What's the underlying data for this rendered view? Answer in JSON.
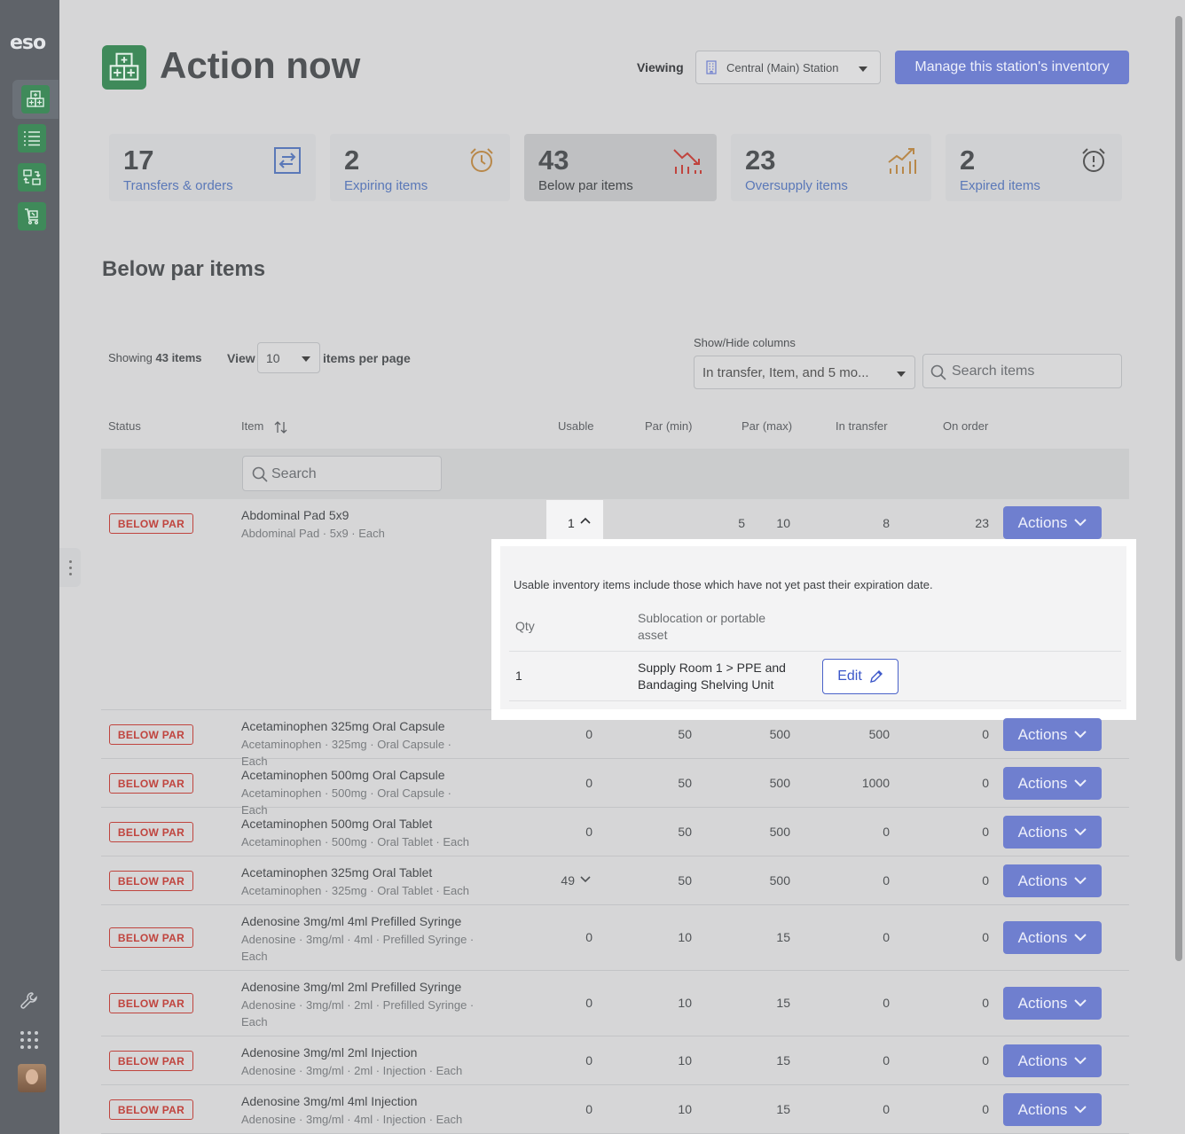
{
  "app": {
    "logo": "eso"
  },
  "header": {
    "title": "Action now",
    "viewing_label": "Viewing",
    "station": "Central (Main) Station",
    "manage_button": "Manage this station's inventory"
  },
  "cards": [
    {
      "count": "17",
      "label": "Transfers & orders",
      "icon": "transfer-icon"
    },
    {
      "count": "2",
      "label": "Expiring items",
      "icon": "alarm-clock-icon"
    },
    {
      "count": "43",
      "label": "Below par items",
      "icon": "chart-down-icon"
    },
    {
      "count": "23",
      "label": "Oversupply items",
      "icon": "chart-up-icon"
    },
    {
      "count": "2",
      "label": "Expired items",
      "icon": "alarm-alert-icon"
    }
  ],
  "section": {
    "title": "Below par items",
    "showing_prefix": "Showing",
    "showing_count": "43 items",
    "view_label": "View",
    "per_page_value": "10",
    "per_page_suffix": "items per page",
    "showhide_label": "Show/Hide columns",
    "columns_value": "In transfer, Item, and 5 mo...",
    "search_placeholder": "Search items"
  },
  "table": {
    "headers": {
      "status": "Status",
      "item": "Item",
      "usable": "Usable",
      "par_min": "Par (min)",
      "par_max": "Par (max)",
      "in_transfer": "In transfer",
      "on_order": "On order"
    },
    "item_search_placeholder": "Search",
    "badge": "BELOW PAR",
    "actions_label": "Actions",
    "rows": [
      {
        "name": "Abdominal Pad 5x9",
        "desc": "Abdominal Pad · 5x9 · Each",
        "usable": "1",
        "par_min": "5",
        "par_max": "10",
        "in_transfer": "8",
        "on_order": "23"
      },
      {
        "name": "Acetaminophen 325mg Oral Capsule",
        "desc": "Acetaminophen · 325mg · Oral Capsule · Each",
        "usable": "0",
        "par_min": "50",
        "par_max": "500",
        "in_transfer": "500",
        "on_order": "0"
      },
      {
        "name": "Acetaminophen 500mg Oral Capsule",
        "desc": "Acetaminophen · 500mg · Oral Capsule · Each",
        "usable": "0",
        "par_min": "50",
        "par_max": "500",
        "in_transfer": "1000",
        "on_order": "0"
      },
      {
        "name": "Acetaminophen 500mg Oral Tablet",
        "desc": "Acetaminophen · 500mg · Oral Tablet · Each",
        "usable": "0",
        "par_min": "50",
        "par_max": "500",
        "in_transfer": "0",
        "on_order": "0"
      },
      {
        "name": "Acetaminophen 325mg Oral Tablet",
        "desc": "Acetaminophen · 325mg · Oral Tablet · Each",
        "usable": "49",
        "par_min": "50",
        "par_max": "500",
        "in_transfer": "0",
        "on_order": "0"
      },
      {
        "name": "Adenosine 3mg/ml 4ml Prefilled Syringe",
        "desc": "Adenosine · 3mg/ml · 4ml · Prefilled Syringe · Each",
        "usable": "0",
        "par_min": "10",
        "par_max": "15",
        "in_transfer": "0",
        "on_order": "0"
      },
      {
        "name": "Adenosine 3mg/ml 2ml Prefilled Syringe",
        "desc": "Adenosine · 3mg/ml · 2ml · Prefilled Syringe · Each",
        "usable": "0",
        "par_min": "10",
        "par_max": "15",
        "in_transfer": "0",
        "on_order": "0"
      },
      {
        "name": "Adenosine 3mg/ml 2ml Injection",
        "desc": "Adenosine · 3mg/ml · 2ml · Injection · Each",
        "usable": "0",
        "par_min": "10",
        "par_max": "15",
        "in_transfer": "0",
        "on_order": "0"
      },
      {
        "name": "Adenosine 3mg/ml 4ml Injection",
        "desc": "Adenosine · 3mg/ml · 4ml · Injection · Each",
        "usable": "0",
        "par_min": "10",
        "par_max": "15",
        "in_transfer": "0",
        "on_order": "0"
      }
    ]
  },
  "popup": {
    "note": "Usable inventory items include those which have not yet past their expiration date.",
    "qty_header": "Qty",
    "location_header": "Sublocation or portable asset",
    "qty": "1",
    "location": "Supply Room 1 > PPE and Bandaging Shelving Unit",
    "edit_label": "Edit"
  }
}
